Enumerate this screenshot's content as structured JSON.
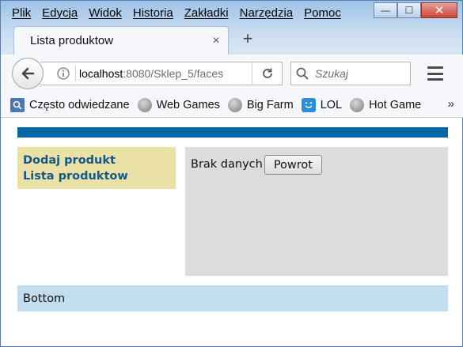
{
  "menubar": {
    "items": [
      "Plik",
      "Edycja",
      "Widok",
      "Historia",
      "Zakładki",
      "Narzędzia",
      "Pomoc"
    ]
  },
  "window_controls": {
    "minimize": "—",
    "maximize": "☐",
    "close": "✕"
  },
  "tab": {
    "title": "Lista produktow",
    "close": "×"
  },
  "newtab": "+",
  "navbar": {
    "url_host": "localhost",
    "url_rest": ":8080/Sklep_5/faces",
    "search_placeholder": "Szukaj"
  },
  "bookmarks": [
    {
      "label": "Często odwiedzane",
      "icon": "bookmark-folder-icon"
    },
    {
      "label": "Web Games",
      "icon": "globe-icon"
    },
    {
      "label": "Big Farm",
      "icon": "globe-icon"
    },
    {
      "label": "LOL",
      "icon": "lol-icon"
    },
    {
      "label": "Hot Game",
      "icon": "globe-icon"
    }
  ],
  "bookmarks_overflow": "»",
  "page": {
    "sidebar": {
      "add_product": "Dodaj produkt",
      "product_list": "Lista produktow"
    },
    "main": {
      "message": "Brak danych",
      "back_button": "Powrot"
    },
    "footer": "Bottom"
  },
  "colors": {
    "topbar": "#0068a6",
    "sidebar_bg": "#ebe1a6",
    "link": "#12588c",
    "main_bg": "#dcdcdc",
    "footer_bg": "#c2ddef"
  }
}
